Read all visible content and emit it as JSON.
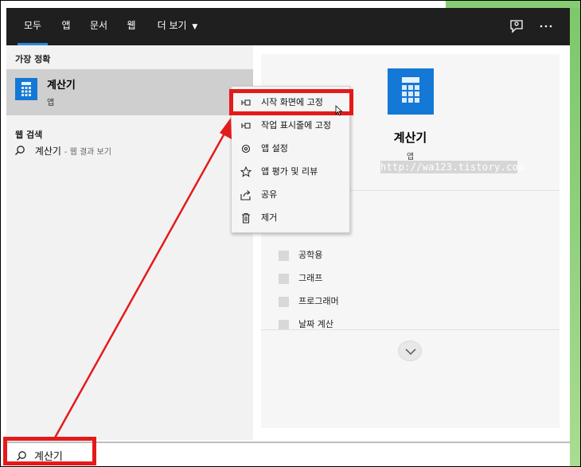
{
  "topbar": {
    "tabs": [
      "모두",
      "앱",
      "문서",
      "웹",
      "더 보기"
    ],
    "active_tab": "모두",
    "accent": "#2e88d8",
    "icons": [
      "feedback-icon",
      "more-icon"
    ]
  },
  "left": {
    "best_match_header": "가장 정확",
    "best_match": {
      "title": "계산기",
      "subtitle": "앱"
    },
    "web_header": "웹 검색",
    "web_result": {
      "query": "계산기",
      "suffix": "- 웹 결과 보기"
    }
  },
  "detail": {
    "title": "계산기",
    "subtitle": "앱",
    "watermark": "http://wa123.tistory.com",
    "modes": [
      "공학용",
      "그래프",
      "프로그래머",
      "날짜 계산"
    ]
  },
  "context_menu": {
    "items": [
      {
        "label": "시작 화면에 고정",
        "icon": "pin-icon"
      },
      {
        "label": "작업 표시줄에 고정",
        "icon": "pin-icon"
      },
      {
        "label": "앱 설정",
        "icon": "gear-icon"
      },
      {
        "label": "앱 평가 및 리뷰",
        "icon": "star-icon"
      },
      {
        "label": "공유",
        "icon": "share-icon"
      },
      {
        "label": "제거",
        "icon": "trash-icon"
      }
    ]
  },
  "search": {
    "value": "계산기"
  },
  "colors": {
    "highlight": "#e41a1a",
    "tile": "#1378d6",
    "topbar": "#1f1f1f"
  }
}
